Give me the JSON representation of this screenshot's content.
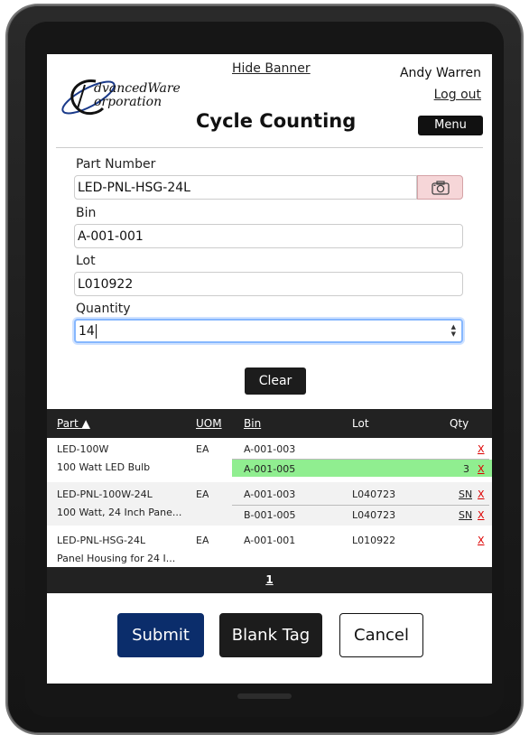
{
  "header": {
    "logo_line1": "dvancedWare",
    "logo_line2": "orporation",
    "hide_banner": "Hide Banner",
    "title": "Cycle Counting",
    "user_name": "Andy Warren",
    "logout": "Log out",
    "menu": "Menu"
  },
  "form": {
    "part_label": "Part Number",
    "part_value": "LED-PNL-HSG-24L",
    "bin_label": "Bin",
    "bin_value": "A-001-001",
    "lot_label": "Lot",
    "lot_value": "L010922",
    "qty_label": "Quantity",
    "qty_value": "14",
    "clear": "Clear"
  },
  "grid": {
    "headers": {
      "part": "Part ▲",
      "uom": "UOM",
      "bin": "Bin",
      "lot": "Lot",
      "qty": "Qty"
    },
    "rows": [
      {
        "part": "LED-100W",
        "desc": "100 Watt LED Bulb",
        "uom": "EA",
        "bins": [
          {
            "bin": "A-001-003",
            "lot": "",
            "qty": "",
            "sn": "",
            "remove": "X"
          },
          {
            "bin": "A-001-005",
            "lot": "",
            "qty": "3",
            "sn": "",
            "remove": "X"
          }
        ]
      },
      {
        "part": "LED-PNL-100W-24L",
        "desc": "100 Watt, 24 Inch Pane...",
        "uom": "EA",
        "bins": [
          {
            "bin": "A-001-003",
            "lot": "L040723",
            "qty": "",
            "sn": "SN",
            "remove": "X"
          },
          {
            "bin": "B-001-005",
            "lot": "L040723",
            "qty": "",
            "sn": "SN",
            "remove": "X"
          }
        ]
      },
      {
        "part": "LED-PNL-HSG-24L",
        "desc": "Panel Housing for 24 I...",
        "uom": "EA",
        "bins": [
          {
            "bin": "A-001-001",
            "lot": "L010922",
            "qty": "",
            "sn": "",
            "remove": "X"
          }
        ]
      }
    ],
    "page": "1"
  },
  "actions": {
    "submit": "Submit",
    "blank_tag": "Blank Tag",
    "cancel": "Cancel"
  },
  "colors": {
    "brand_navy": "#0b2d6b",
    "dark": "#1c1c1c",
    "highlight_green": "#90ee90",
    "remove_red": "#dd0000",
    "camera_pink": "#f6d6d8"
  }
}
